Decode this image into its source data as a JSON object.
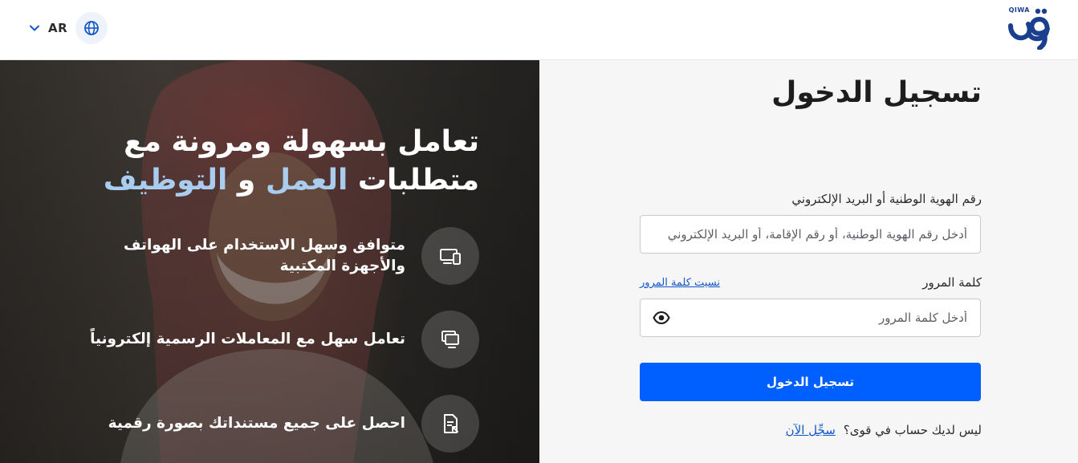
{
  "header": {
    "language_code": "AR",
    "logo_label": "QIWA",
    "icons": {
      "chevron": "chevron-down-icon",
      "globe": "globe-icon",
      "logo": "qiwa-logo"
    }
  },
  "hero": {
    "title_line1": "تعامل بسهولة ومرونة مع",
    "title_line2_part1": "متطلبات",
    "title_line2_hl1": "العمل",
    "title_line2_mid": "و",
    "title_line2_hl2": "التوظيف",
    "features": [
      {
        "text": "متوافق وسهل الاستخدام على الهواتف والأجهزة المكتبية",
        "icon": "devices-icon"
      },
      {
        "text": "تعامل سهل مع المعاملات الرسمية إلكترونياً",
        "icon": "monitor-icon"
      },
      {
        "text": "احصل على جميع مستنداتك بصورة رقمية",
        "icon": "document-icon"
      }
    ]
  },
  "login": {
    "title": "تسجيل الدخول",
    "id_label": "رقم الهوية الوطنية أو البريد الإلكتروني",
    "id_placeholder": "أدخل رقم الهوية الوطنية، أو رقم الإقامة، أو البريد الإلكتروني",
    "password_label": "كلمة المرور",
    "forgot_password": "نسيت كلمة المرور",
    "password_placeholder": "أدخل كلمة المرور",
    "submit_label": "تسجيل الدخول",
    "no_account": "ليس لديك حساب في قوى؟",
    "register_now": "سجِّل الآن"
  },
  "colors": {
    "primary": "#0060ff",
    "link": "#1456c8",
    "highlight": "#a9cdee",
    "logo": "#1b3f8f"
  }
}
